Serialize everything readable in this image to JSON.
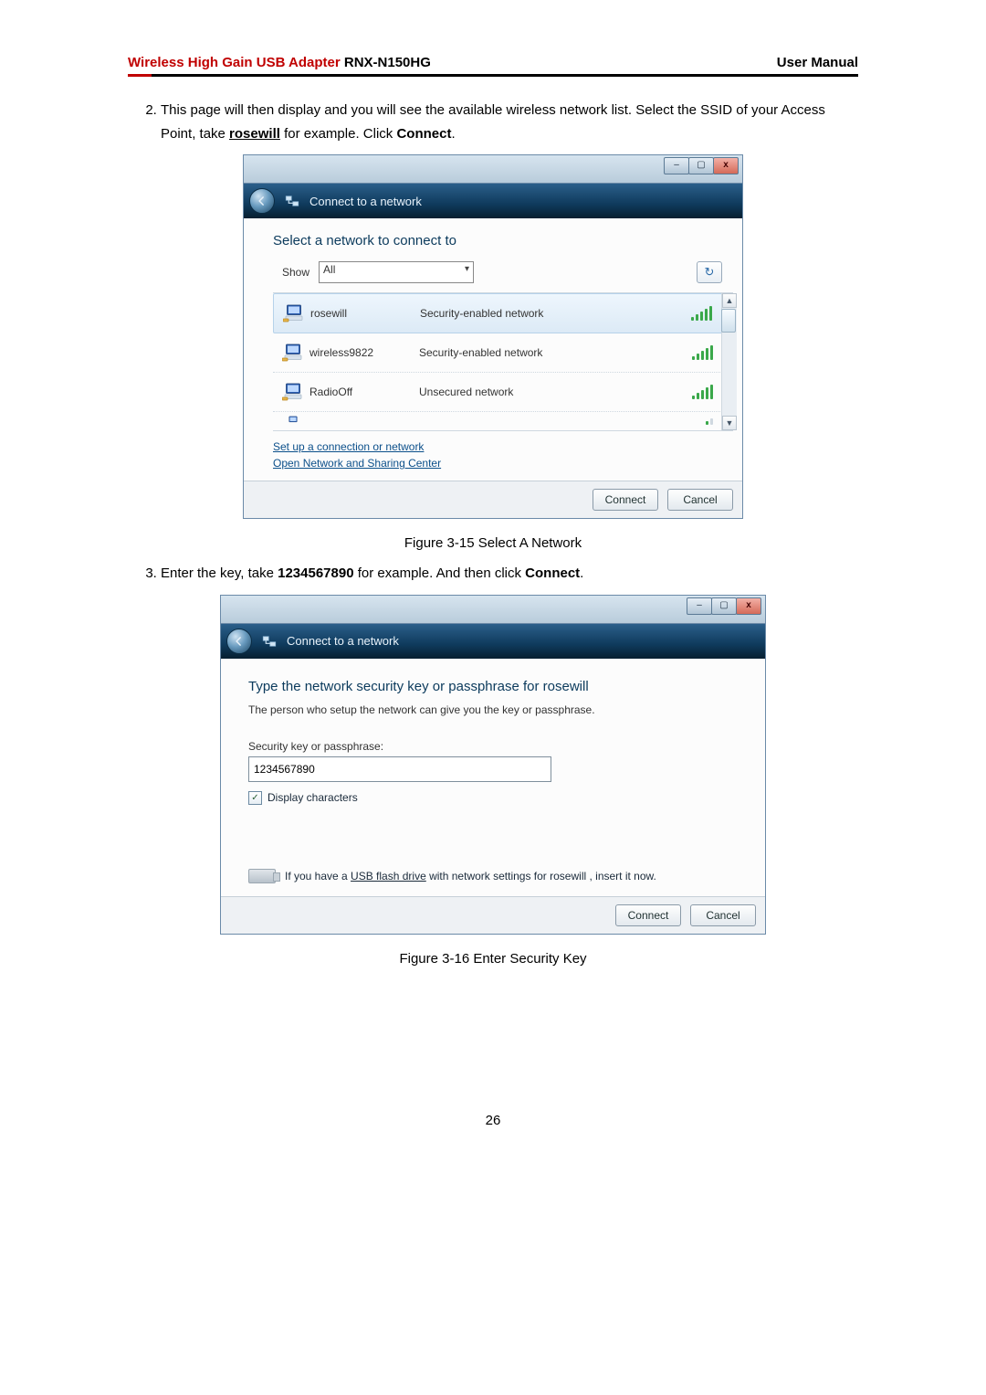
{
  "header": {
    "title_red": "Wireless High Gain USB Adapter",
    "title_black": " RNX-N150HG",
    "right": "User Manual"
  },
  "steps": {
    "step2_a": "This page will then display and you will see the available wireless network list. Select the SSID of your Access Point, take ",
    "step2_b": "rosewill",
    "step2_c": " for example. Click ",
    "step2_d": "Connect",
    "step2_e": ".",
    "step3_a": "Enter the key, take ",
    "step3_b": "1234567890",
    "step3_c": " for example. And then click ",
    "step3_d": "Connect",
    "step3_e": "."
  },
  "fig1_caption": "Figure 3-15 Select A Network",
  "fig2_caption": "Figure 3-16 Enter Security Key",
  "page_number": "26",
  "win1": {
    "nav_title": "Connect to a network",
    "heading": "Select a network to connect to",
    "show_label": "Show",
    "show_value": "All",
    "networks": [
      {
        "ssid": "rosewill",
        "security": "Security-enabled network",
        "selected": true
      },
      {
        "ssid": "wireless9822",
        "security": "Security-enabled network",
        "selected": false
      },
      {
        "ssid": "RadioOff",
        "security": "Unsecured network",
        "selected": false
      }
    ],
    "link1": "Set up a connection or network",
    "link2": "Open Network and Sharing Center",
    "connect": "Connect",
    "cancel": "Cancel"
  },
  "win2": {
    "nav_title": "Connect to a network",
    "heading_a": "Type the network security key or passphrase for ",
    "heading_b": "rosewill",
    "subtext": "The person who setup the network can give you the key or passphrase.",
    "field_label": "Security key or passphrase:",
    "field_value": "1234567890",
    "checkbox_label": "Display characters",
    "usb_a": "If you have a ",
    "usb_b": "USB flash drive",
    "usb_c": " with network settings for  rosewill , insert it now.",
    "connect": "Connect",
    "cancel": "Cancel"
  }
}
